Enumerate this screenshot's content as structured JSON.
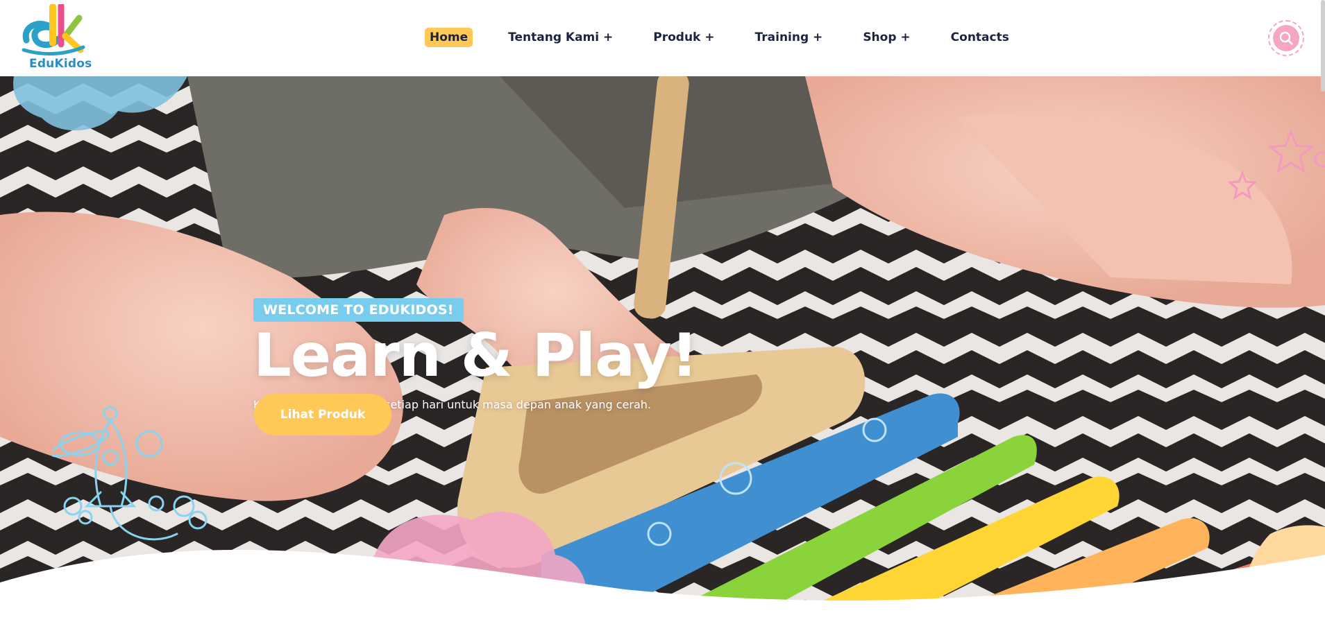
{
  "brand": {
    "name": "EduKidos"
  },
  "nav": {
    "items": [
      {
        "label": "Home",
        "active": true
      },
      {
        "label": "Tentang Kami +"
      },
      {
        "label": "Produk +"
      },
      {
        "label": "Training +"
      },
      {
        "label": "Shop +"
      },
      {
        "label": "Contacts"
      }
    ]
  },
  "search": {
    "icon": "search-icon"
  },
  "hero": {
    "badge": "WELCOME TO EDUKIDOS!",
    "title": "Learn & Play!",
    "subtitle": "Kami membuat inovasi setiap hari untuk masa depan anak yang cerah.",
    "cta_label": "Lihat Produk"
  },
  "colors": {
    "accent_yellow": "#ffc857",
    "badge_blue": "#78cdee",
    "search_pink": "#f6a6c1",
    "nav_text": "#1c2340"
  }
}
